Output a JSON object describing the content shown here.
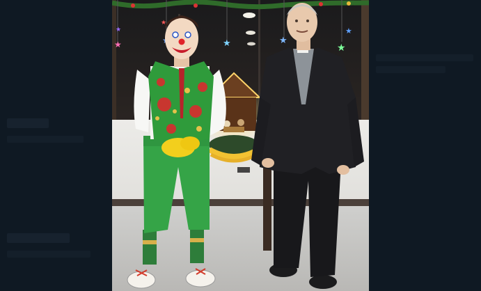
{
  "viewer": {
    "background_color": "#0e1721"
  },
  "photo": {
    "subject": "photo"
  },
  "icons": {
    "star_lights": "star-icon"
  }
}
